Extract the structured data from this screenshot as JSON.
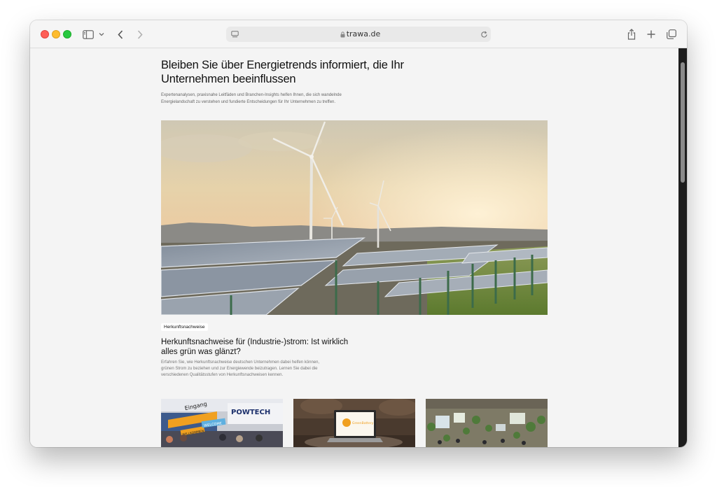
{
  "browser": {
    "url": "trawa.de"
  },
  "page": {
    "headline": "Bleiben Sie über Energietrends informiert, die Ihr Unternehmen beeinflussen",
    "intro": "Expertenanalysen, praxisnahe Leitfäden und Branchen-Insights helfen Ihnen, die sich wandelnde Energielandschaft zu verstehen und fundierte Entscheidungen für Ihr Unternehmen zu treffen.",
    "featured": {
      "tag": "Herkunftsnachweise",
      "title": "Herkunftsnachweise für (Industrie-)strom: Ist wirklich alles grün was glänzt?",
      "description": "Erfahren Sie, wie Herkunftsnachweise deutschen Unternehmen dabei helfen können, grünen Strom zu beziehen und zur Energiewende beizutragen. Lernen Sie dabei die verschiedenen Qualitätsstufen von Herkunftsnachweisen kennen."
    },
    "thumbnails": {
      "expo_sign_1": "WILLKOMMEN",
      "expo_sign_2": "WELCOME",
      "expo_sign_3": "POWTECH",
      "expo_sign_4": "Eingang",
      "laptop_screen": "GreenBattery"
    }
  },
  "colors": {
    "accent_orange": "#f0a020",
    "window_bg": "#f4f4f4"
  }
}
